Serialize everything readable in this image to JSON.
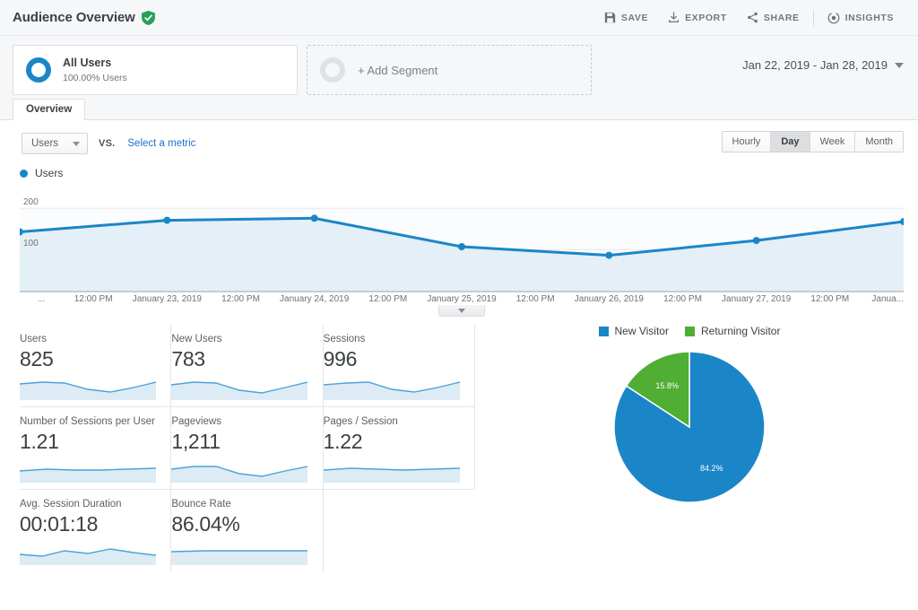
{
  "header": {
    "title": "Audience Overview",
    "verified_icon": "shield-check-icon",
    "actions": [
      {
        "label": "SAVE",
        "icon": "save-icon"
      },
      {
        "label": "EXPORT",
        "icon": "export-icon"
      },
      {
        "label": "SHARE",
        "icon": "share-icon"
      },
      {
        "label": "INSIGHTS",
        "icon": "insights-icon"
      }
    ]
  },
  "segments": {
    "all_users": {
      "name": "All Users",
      "sub": "100.00% Users"
    },
    "add_segment": {
      "label": "+ Add Segment"
    }
  },
  "date_range": {
    "value": "Jan 22, 2019 - Jan 28, 2019"
  },
  "tabs": [
    {
      "label": "Overview",
      "active": true
    }
  ],
  "controls": {
    "metric_select": "Users",
    "vs_label": "VS.",
    "select_metric_link": "Select a metric",
    "granularity": [
      "Hourly",
      "Day",
      "Week",
      "Month"
    ],
    "granularity_active": "Day"
  },
  "chart_legend": {
    "label": "Users",
    "color": "#1a86c8"
  },
  "chart_data": {
    "type": "line",
    "title": "Users",
    "xlabel": "",
    "ylabel": "Users",
    "ylim": [
      0,
      240
    ],
    "yticks": [
      100,
      200
    ],
    "grid": true,
    "legend": "Users",
    "series_color": "#1a86c8",
    "area_color": "#e4eff7",
    "categories": [
      "January 22, 2019",
      "January 23, 2019",
      "January 24, 2019",
      "January 25, 2019",
      "January 26, 2019",
      "January 27, 2019",
      "January 28, 2019"
    ],
    "values": [
      143,
      171,
      176,
      107,
      86,
      122,
      168
    ],
    "xtick_labels": [
      "...",
      "12:00 PM",
      "January 23, 2019",
      "12:00 PM",
      "January 24, 2019",
      "12:00 PM",
      "January 25, 2019",
      "12:00 PM",
      "January 26, 2019",
      "12:00 PM",
      "January 27, 2019",
      "12:00 PM",
      "Janua..."
    ]
  },
  "collapse_handle": {
    "icon": "chevron-down-icon"
  },
  "metrics": [
    [
      {
        "name": "Users",
        "value": "825"
      },
      {
        "name": "New Users",
        "value": "783"
      },
      {
        "name": "Sessions",
        "value": "996"
      }
    ],
    [
      {
        "name": "Number of Sessions per User",
        "value": "1.21"
      },
      {
        "name": "Pageviews",
        "value": "1,211"
      },
      {
        "name": "Pages / Session",
        "value": "1.22"
      }
    ],
    [
      {
        "name": "Avg. Session Duration",
        "value": "00:01:18"
      },
      {
        "name": "Bounce Rate",
        "value": "86.04%"
      }
    ]
  ],
  "pie_chart": {
    "chart_data": {
      "type": "pie",
      "title": "",
      "labels": [
        "New Visitor",
        "Returning Visitor"
      ],
      "values": [
        84.2,
        15.8
      ],
      "display_values": [
        "84.2%",
        "15.8%"
      ],
      "colors": [
        "#1a86c8",
        "#4fae33"
      ],
      "legend_position": "top"
    }
  }
}
